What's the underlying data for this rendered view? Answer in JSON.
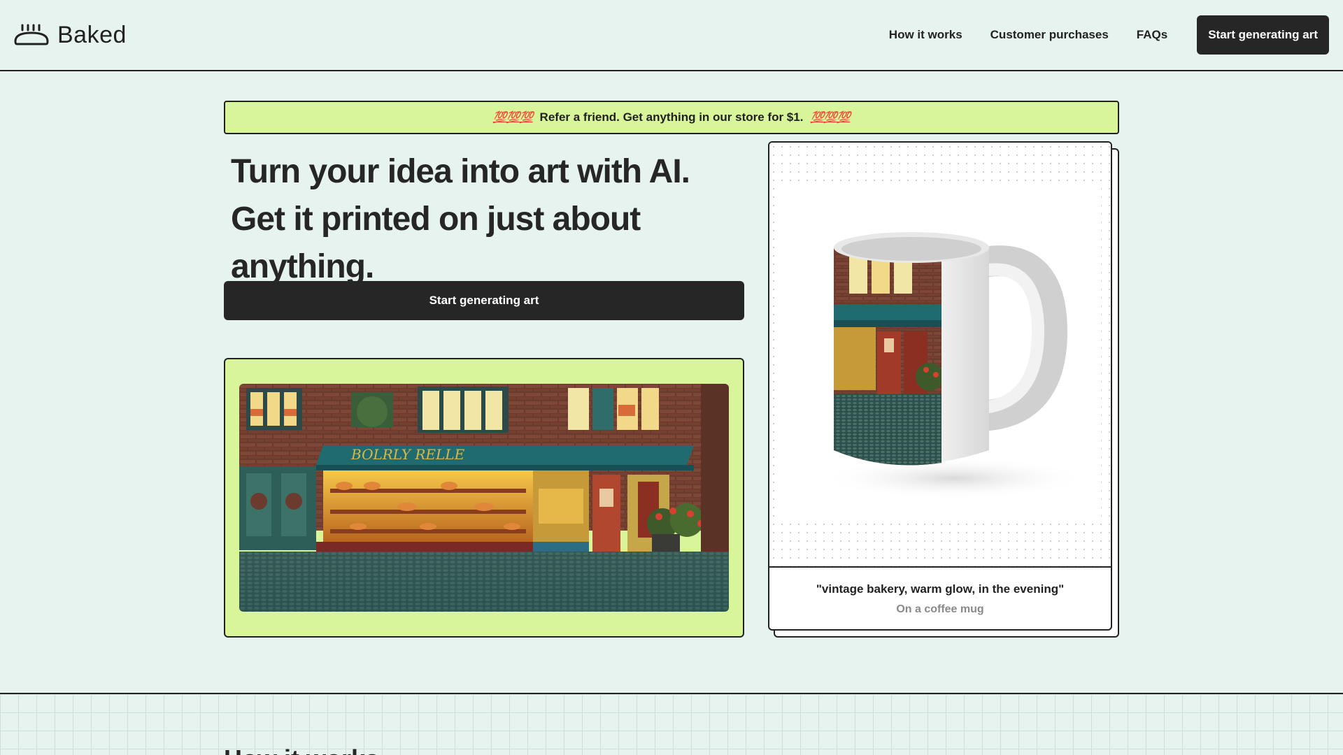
{
  "header": {
    "logo_text": "Baked",
    "nav": [
      {
        "label": "How it works"
      },
      {
        "label": "Customer purchases"
      },
      {
        "label": "FAQs"
      }
    ],
    "cta_label": "Start generating art"
  },
  "banner": {
    "emoji_left": "💯💯💯",
    "text": "Refer a friend. Get anything in our store for $1.",
    "emoji_right": "💯💯💯"
  },
  "hero": {
    "line1": "Turn your idea into art with AI.",
    "line2": "Get it printed on just about anything.",
    "cta_label": "Start generating art"
  },
  "art_card": {
    "storefront_sign": "BOLRLY RELLE",
    "image_icon": "bakery-storefront-image"
  },
  "product": {
    "image_icon": "coffee-mug-image",
    "quote": "\"vintage bakery, warm glow, in the evening\"",
    "subtitle": "On a coffee mug"
  },
  "section": {
    "heading": "How it works"
  },
  "colors": {
    "background": "#e6f3ee",
    "accent": "#d9f59a",
    "dark": "#262626"
  }
}
